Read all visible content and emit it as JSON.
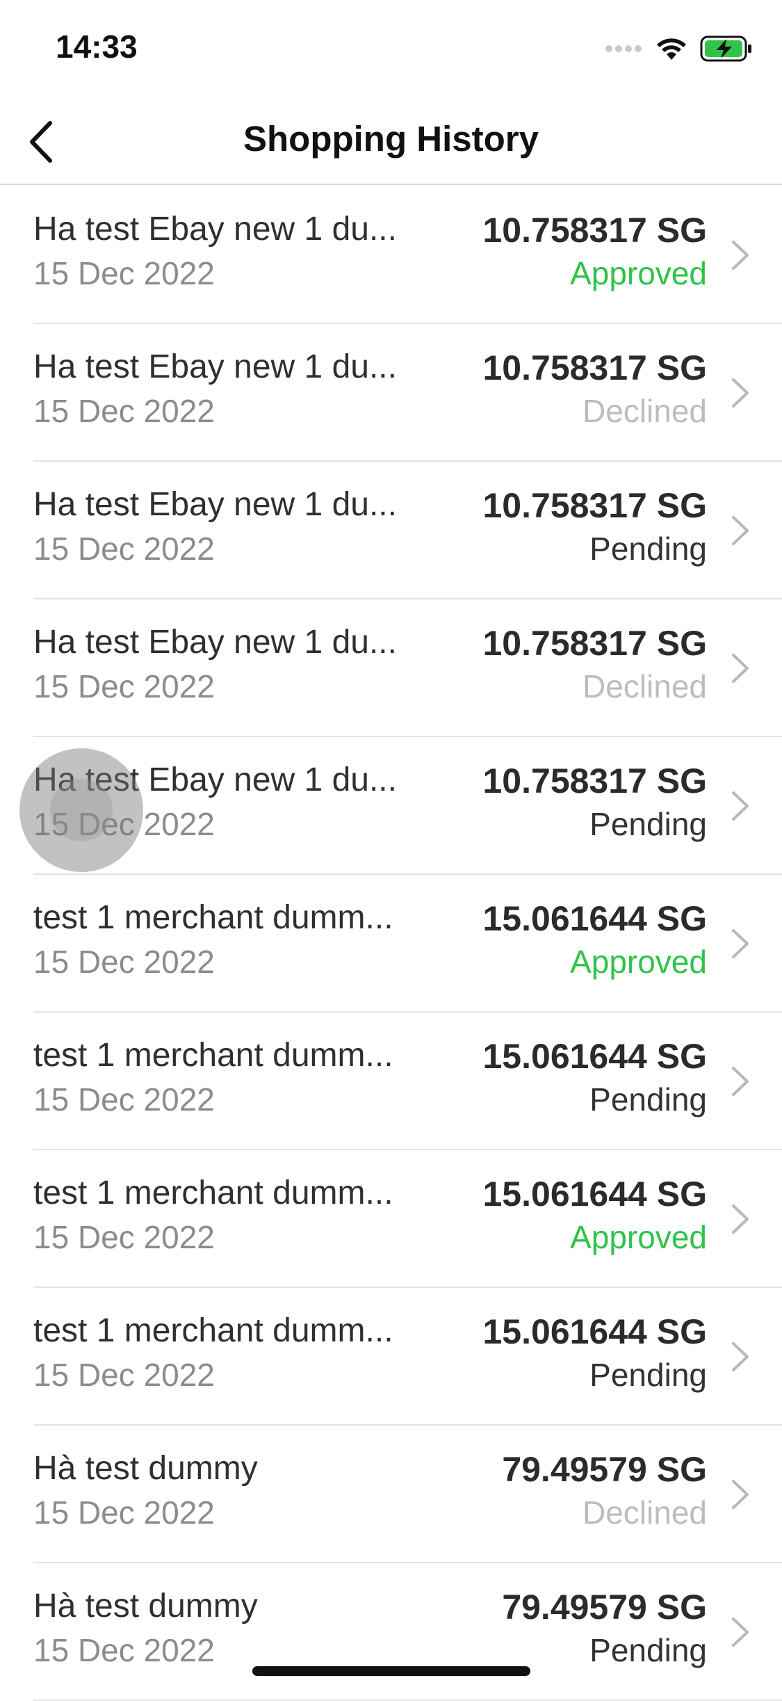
{
  "status_bar": {
    "time": "14:33",
    "icons": [
      "signal-dots-icon",
      "wifi-icon",
      "battery-charging-icon"
    ]
  },
  "nav": {
    "back_icon": "chevron-left-icon",
    "title": "Shopping History"
  },
  "colors": {
    "approved": "#2fc34a",
    "declined": "#bcbcbc",
    "pending": "#333333"
  },
  "transactions": [
    {
      "name": "Ha test Ebay new 1 du...",
      "date": "15 Dec 2022",
      "amount": "10.758317 SG",
      "status": "Approved"
    },
    {
      "name": "Ha test Ebay new 1 du...",
      "date": "15 Dec 2022",
      "amount": "10.758317 SG",
      "status": "Declined"
    },
    {
      "name": "Ha test Ebay new 1 du...",
      "date": "15 Dec 2022",
      "amount": "10.758317 SG",
      "status": "Pending"
    },
    {
      "name": "Ha test Ebay new 1 du...",
      "date": "15 Dec 2022",
      "amount": "10.758317 SG",
      "status": "Declined"
    },
    {
      "name": "Ha test Ebay new 1 du...",
      "date": "15 Dec 2022",
      "amount": "10.758317 SG",
      "status": "Pending"
    },
    {
      "name": "test 1 merchant dumm...",
      "date": "15 Dec 2022",
      "amount": "15.061644 SG",
      "status": "Approved"
    },
    {
      "name": "test 1 merchant dumm...",
      "date": "15 Dec 2022",
      "amount": "15.061644 SG",
      "status": "Pending"
    },
    {
      "name": "test 1 merchant dumm...",
      "date": "15 Dec 2022",
      "amount": "15.061644 SG",
      "status": "Approved"
    },
    {
      "name": "test 1 merchant dumm...",
      "date": "15 Dec 2022",
      "amount": "15.061644 SG",
      "status": "Pending"
    },
    {
      "name": "Hà test dummy",
      "date": "15 Dec 2022",
      "amount": "79.49579 SG",
      "status": "Declined"
    },
    {
      "name": "Hà test dummy",
      "date": "15 Dec 2022",
      "amount": "79.49579 SG",
      "status": "Pending"
    }
  ]
}
